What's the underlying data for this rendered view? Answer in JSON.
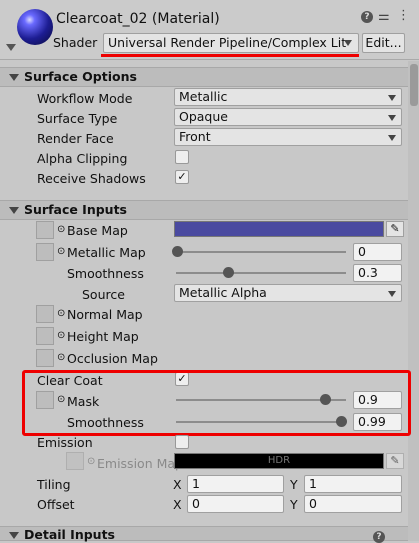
{
  "header": {
    "title": "Clearcoat_02 (Material)",
    "shader_label": "Shader",
    "shader_value": "Universal Render Pipeline/Complex Lit",
    "edit_label": "Edit...",
    "icons": [
      "help-icon",
      "settings-sliders-icon",
      "more-menu-icon"
    ]
  },
  "surface_options": {
    "title": "Surface Options",
    "workflow_label": "Workflow Mode",
    "workflow_value": "Metallic",
    "surface_type_label": "Surface Type",
    "surface_type_value": "Opaque",
    "render_face_label": "Render Face",
    "render_face_value": "Front",
    "alpha_clip_label": "Alpha Clipping",
    "alpha_clip_checked": false,
    "receive_shadows_label": "Receive Shadows",
    "receive_shadows_checked": true
  },
  "surface_inputs": {
    "title": "Surface Inputs",
    "base_map_label": "Base Map",
    "base_color": "#4a4aa0",
    "metallic_label": "Metallic Map",
    "metallic_value": "0",
    "smoothness_label": "Smoothness",
    "smoothness_value": "0.3",
    "source_label": "Source",
    "source_value": "Metallic Alpha",
    "normal_label": "Normal Map",
    "height_label": "Height Map",
    "occlusion_label": "Occlusion Map",
    "clear_coat_label": "Clear Coat",
    "clear_coat_checked": true,
    "mask_label": "Mask",
    "mask_value": "0.9",
    "cc_smoothness_label": "Smoothness",
    "cc_smoothness_value": "0.99",
    "emission_label": "Emission",
    "emission_checked": false,
    "emission_map_label": "Emission Map",
    "emission_hdr": "HDR",
    "tiling_label": "Tiling",
    "tiling_x": "1",
    "tiling_y": "1",
    "offset_label": "Offset",
    "offset_x": "0",
    "offset_y": "0",
    "x_label": "X",
    "y_label": "Y"
  },
  "detail_inputs": {
    "title": "Detail Inputs"
  }
}
